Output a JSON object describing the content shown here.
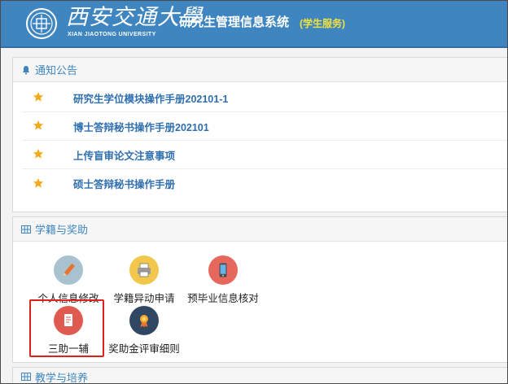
{
  "header": {
    "university_cn": "西安交通大學",
    "university_en": "XIAN JIAOTONG UNIVERSITY",
    "system_title": "研究生管理信息系统",
    "system_subtitle": "(学生服务)",
    "colors": {
      "bar": "#3f86c0",
      "subtitle": "#f5e23a"
    }
  },
  "notices": {
    "title": "通知公告",
    "icon": "bell-icon",
    "items": [
      {
        "icon": "star-icon",
        "label": "研究生学位模块操作手册202101-1"
      },
      {
        "icon": "star-icon",
        "label": "博士答辩秘书操作手册202101"
      },
      {
        "icon": "star-icon",
        "label": "上传盲审论文注意事项"
      },
      {
        "icon": "star-icon",
        "label": "硕士答辩秘书操作手册"
      }
    ]
  },
  "registration": {
    "title": "学籍与奖助",
    "icon": "grid-icon",
    "apps": [
      {
        "icon": "pencil-icon",
        "label": "个人信息修改"
      },
      {
        "icon": "printer-icon",
        "label": "学籍异动申请"
      },
      {
        "icon": "phone-icon",
        "label": "预毕业信息核对"
      },
      {
        "icon": "document-icon",
        "label": "三助一辅",
        "highlighted": true
      },
      {
        "icon": "award-icon",
        "label": "奖助金评审细则"
      }
    ]
  },
  "teaching": {
    "title": "教学与培养",
    "icon": "grid-icon"
  }
}
